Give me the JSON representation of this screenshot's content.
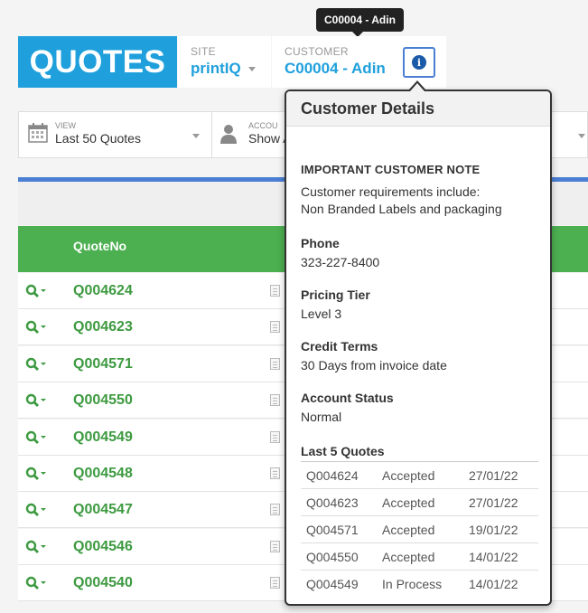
{
  "tooltip": "C00004 - Adin",
  "header": {
    "title": "QUOTES",
    "site_label": "SITE",
    "site_value": "printIQ",
    "customer_label": "CUSTOMER",
    "customer_value": "C00004 - Adin"
  },
  "filters": {
    "view_label": "VIEW",
    "view_value": "Last 50 Quotes",
    "account_label": "ACCOU",
    "account_value": "Show A"
  },
  "table": {
    "header_quoteno": "QuoteNo",
    "rows": [
      "Q004624",
      "Q004623",
      "Q004571",
      "Q004550",
      "Q004549",
      "Q004548",
      "Q004547",
      "Q004546",
      "Q004540"
    ]
  },
  "popover": {
    "title": "Customer Details",
    "note_title": "IMPORTANT CUSTOMER NOTE",
    "note_line1": "Customer requirements include:",
    "note_line2": "Non Branded Labels and packaging",
    "phone_title": "Phone",
    "phone_value": "323-227-8400",
    "tier_title": "Pricing Tier",
    "tier_value": "Level 3",
    "credit_title": "Credit Terms",
    "credit_value": "30 Days from invoice date",
    "status_title": "Account Status",
    "status_value": "Normal",
    "last_title": "Last 5 Quotes",
    "last_quotes": [
      {
        "no": "Q004624",
        "status": "Accepted",
        "date": "27/01/22"
      },
      {
        "no": "Q004623",
        "status": "Accepted",
        "date": "27/01/22"
      },
      {
        "no": "Q004571",
        "status": "Accepted",
        "date": "19/01/22"
      },
      {
        "no": "Q004550",
        "status": "Accepted",
        "date": "14/01/22"
      },
      {
        "no": "Q004549",
        "status": "In Process",
        "date": "14/01/22"
      }
    ]
  },
  "icons": {
    "info": "info-icon",
    "calendar": "calendar-icon",
    "user": "user-icon",
    "search": "search-dropdown-icon",
    "document": "document-icon"
  },
  "colors": {
    "brand_blue": "#1fa0dc",
    "table_green": "#4caf50",
    "quote_green": "#3d9a40",
    "accent_blue": "#4a7fd4"
  }
}
